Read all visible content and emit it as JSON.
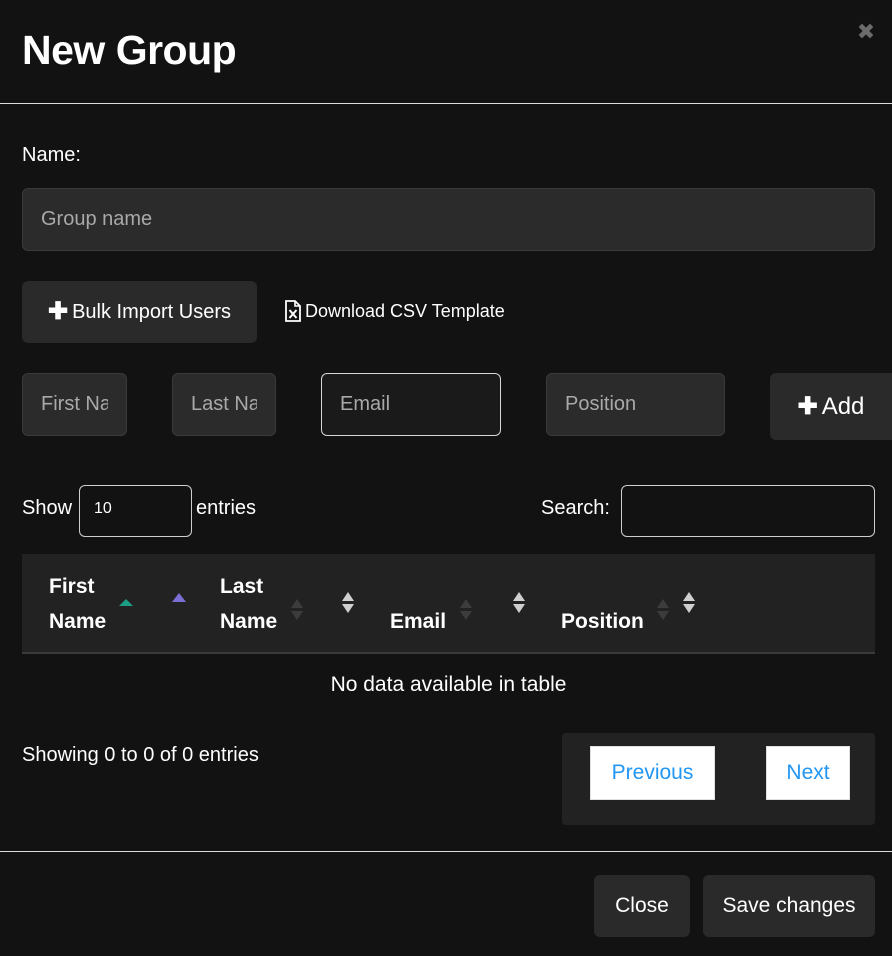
{
  "modal": {
    "title": "New Group",
    "close_glyph": "✖"
  },
  "name_field": {
    "label": "Name:",
    "placeholder": "Group name"
  },
  "import": {
    "bulk_label": "Bulk Import Users",
    "plus_glyph": "✚",
    "csv_label": "Download CSV Template",
    "csv_icon": "file-excel-icon"
  },
  "user_form": {
    "first_name_placeholder": "First Name",
    "last_name_placeholder": "Last Name",
    "email_placeholder": "Email",
    "position_placeholder": "Position",
    "add_label": "Add"
  },
  "table_controls": {
    "show_label": "Show",
    "entries_value": "10",
    "entries_label": "entries",
    "search_label": "Search:",
    "search_value": ""
  },
  "table": {
    "columns": [
      {
        "line1": "First",
        "line2": "Name"
      },
      {
        "line1": "Last",
        "line2": "Name"
      },
      {
        "line1": "",
        "line2": "Email"
      },
      {
        "line1": "",
        "line2": "Position"
      }
    ],
    "empty_message": "No data available in table"
  },
  "pagination": {
    "info": "Showing 0 to 0 of 0 entries",
    "previous_label": "Previous",
    "next_label": "Next"
  },
  "footer": {
    "close_label": "Close",
    "save_label": "Save changes"
  },
  "colors": {
    "background": "#121212",
    "input_bg": "#2b2b2b",
    "link_blue": "#2196f3",
    "sort_teal": "#1e9e86",
    "sort_purple": "#7b6fd6"
  }
}
